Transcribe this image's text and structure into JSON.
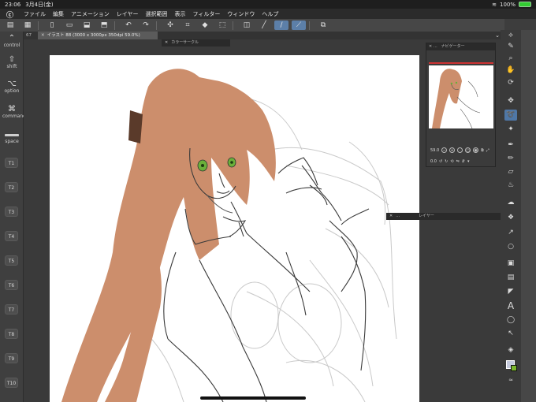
{
  "status_bar": {
    "time": "23:06",
    "date": "3月4日(金)",
    "battery_percent": "100%",
    "battery_level": 1.0
  },
  "menu": {
    "items": [
      "ファイル",
      "編集",
      "アニメーション",
      "レイヤー",
      "選択範囲",
      "表示",
      "フィルター",
      "ウィンドウ",
      "ヘルプ"
    ]
  },
  "command_bar": {
    "buttons": [
      "layer-stack-icon",
      "grid-icon",
      "new-file-icon",
      "open-file-icon",
      "save-icon",
      "export-icon",
      "undo-icon",
      "redo-icon",
      "transform-icon",
      "crop-icon",
      "fill-icon",
      "snap-icon",
      "ruler-icon",
      "pen-stroke-icon",
      "pen-correct-icon",
      "copy-icon"
    ]
  },
  "document": {
    "tab_zoom_left": "67",
    "tab_title": "イラスト 88 (3000 x 3000px 350dpi 59.0%)"
  },
  "left_panel": {
    "modifiers": [
      {
        "sym": "",
        "label": "control"
      },
      {
        "sym": "⇧",
        "label": "shift"
      },
      {
        "sym": "⌥",
        "label": "option"
      },
      {
        "sym": "⌘",
        "label": "command"
      },
      {
        "sym": "",
        "label": "space"
      }
    ],
    "function_keys": [
      "T1",
      "T2",
      "T3",
      "T4",
      "T5",
      "T6",
      "T7",
      "T8",
      "T9",
      "T10"
    ]
  },
  "palettes": {
    "color_circle_title": "カラーサークル",
    "navigator_title": "ナビゲーター",
    "layer_title": "レイヤー",
    "navigator_zoom": "59.0",
    "navigator_angle": "0.0"
  },
  "tools": [
    "hand-drag-icon",
    "eyedropper-icon",
    "zoom-icon",
    "hand-icon",
    "rotate-icon",
    "move-icon",
    "lasso-icon",
    "magic-wand-icon",
    "pen-icon",
    "pencil-icon",
    "eraser-icon",
    "blend-icon",
    "airbrush-icon",
    "decoration-icon",
    "vector-icon",
    "figure-icon",
    "frame-icon",
    "gradient-icon",
    "text-icon",
    "balloon-icon",
    "correct-line-icon",
    "fill-icon"
  ],
  "active_tool": "lasso-icon",
  "colors": {
    "canvas_bg": "#3a3a3a",
    "paper": "#ffffff",
    "hair": "#cc8e6c",
    "eyes": "#6ab03a",
    "main_color": "#c4c9dc",
    "sub_color": "#7ab52c",
    "accent": "#4f77a6"
  }
}
